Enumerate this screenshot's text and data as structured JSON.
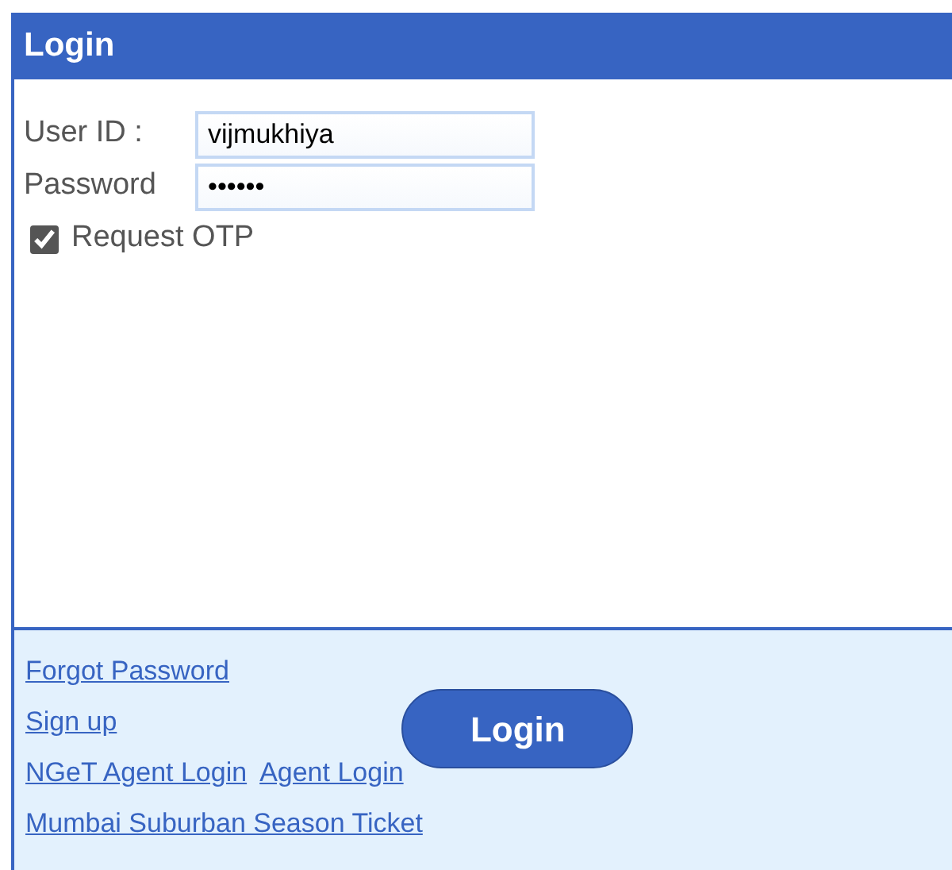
{
  "panel": {
    "title": "Login"
  },
  "fields": [
    {
      "label": "User ID :",
      "value": "vijmukhiya"
    },
    {
      "label": "Password",
      "value": "••••••"
    }
  ],
  "checkbox": {
    "label": "Request OTP",
    "checked": true
  },
  "links": [
    [
      "Forgot Password"
    ],
    [
      "Sign up"
    ],
    [
      "NGeT Agent Login",
      "Agent Login"
    ],
    [
      "Mumbai Suburban Season Ticket"
    ]
  ],
  "login_button": "Login"
}
